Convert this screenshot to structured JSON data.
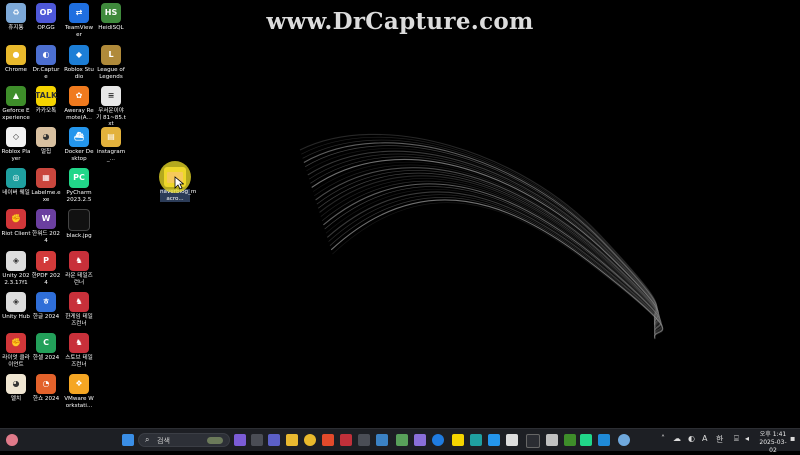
{
  "watermark": "www.DrCapture.com",
  "desktop_icons": [
    {
      "id": "recycle-bin",
      "label": "휴지통",
      "color": "#7da9d8",
      "glyph": "♻"
    },
    {
      "id": "opgg",
      "label": "OP.GG",
      "color": "#4e58d8",
      "glyph": "OP"
    },
    {
      "id": "teamviewer",
      "label": "TeamViewer",
      "color": "#1f6fe0",
      "glyph": "⇄"
    },
    {
      "id": "heidisql",
      "label": "HeidiSQL",
      "color": "#3f8a3c",
      "glyph": "HS"
    },
    {
      "id": "chrome",
      "label": "Chrome",
      "color": "#e9b92c",
      "glyph": "●"
    },
    {
      "id": "drcapture",
      "label": "Dr.Capture",
      "color": "#4c6fd0",
      "glyph": "◐"
    },
    {
      "id": "roblox-studio",
      "label": "Roblox Studio",
      "color": "#1c7ed6",
      "glyph": "◆"
    },
    {
      "id": "league",
      "label": "League of Legends",
      "color": "#b08a3a",
      "glyph": "L"
    },
    {
      "id": "geforce",
      "label": "Geforce Experience",
      "color": "#3e8e2a",
      "glyph": "▲"
    },
    {
      "id": "kakaotalk",
      "label": "카카오톡",
      "color": "#f5d400",
      "glyph": "TALK"
    },
    {
      "id": "aweray",
      "label": "Aweray Remote(A...",
      "color": "#f07a1e",
      "glyph": "✿"
    },
    {
      "id": "story-txt",
      "label": "무서운이야기 81~85.txt",
      "color": "#e8e8e8",
      "glyph": "≡"
    },
    {
      "id": "roblox-player",
      "label": "Roblox Player",
      "color": "#f2f2f2",
      "glyph": "◇"
    },
    {
      "id": "baram",
      "label": "멀칩",
      "color": "#d8c0a0",
      "glyph": "◕"
    },
    {
      "id": "docker",
      "label": "Docker Desktop",
      "color": "#2496ed",
      "glyph": "⛴"
    },
    {
      "id": "instagram",
      "label": "instagram_...",
      "color": "#e3b23c",
      "glyph": "▤"
    },
    {
      "id": "naver-whale",
      "label": "네이버 웨일",
      "color": "#1fa0a0",
      "glyph": "◎"
    },
    {
      "id": "labelme",
      "label": "Labelme.exe",
      "color": "#c9463d",
      "glyph": "▦"
    },
    {
      "id": "pycharm",
      "label": "PyCharm 2023.2.5",
      "color": "#21d789",
      "glyph": "PC"
    },
    {
      "id": "riot",
      "label": "Riot Client",
      "color": "#d13639",
      "glyph": "✊"
    },
    {
      "id": "hanword",
      "label": "한워드 2024",
      "color": "#6b3fa0",
      "glyph": "W"
    },
    {
      "id": "black-jpg",
      "label": "black.jpg",
      "color": "#111111",
      "glyph": ""
    },
    {
      "id": "unity",
      "label": "Unity 2022.3.17f1",
      "color": "#dddddd",
      "glyph": "◈"
    },
    {
      "id": "hanpdf",
      "label": "한PDF 2024",
      "color": "#d23a3a",
      "glyph": "P"
    },
    {
      "id": "race-tales",
      "label": "라운 테일즈런너",
      "color": "#c8303a",
      "glyph": "♞"
    },
    {
      "id": "unity-hub",
      "label": "Unity Hub",
      "color": "#dddddd",
      "glyph": "◈"
    },
    {
      "id": "hangul",
      "label": "한글 2024",
      "color": "#2f6ed8",
      "glyph": "ㅎ"
    },
    {
      "id": "hangame-tales",
      "label": "한게임 테일즈런너",
      "color": "#c8303a",
      "glyph": "♞"
    },
    {
      "id": "riot-client-kr",
      "label": "라이엇 클라이언트",
      "color": "#d13639",
      "glyph": "✊"
    },
    {
      "id": "hancell",
      "label": "한셀 2024",
      "color": "#23a05a",
      "glyph": "C"
    },
    {
      "id": "stove-tales",
      "label": "스토브 테일즈런너",
      "color": "#c8303a",
      "glyph": "♞"
    },
    {
      "id": "melchi",
      "label": "멜치",
      "color": "#f0e6d2",
      "glyph": "◕"
    },
    {
      "id": "hanshow",
      "label": "한쇼 2024",
      "color": "#e3622b",
      "glyph": "◔"
    },
    {
      "id": "vmware",
      "label": "VMware Workstati...",
      "color": "#f5a623",
      "glyph": "❖"
    }
  ],
  "dragged_icon": {
    "label": "naverblog_m acro..."
  },
  "taskbar": {
    "search_placeholder": "검색",
    "tray_lang": "A",
    "tray_ime": "한",
    "clock_time": "오후 1:41",
    "clock_date": "2025-03-02"
  }
}
